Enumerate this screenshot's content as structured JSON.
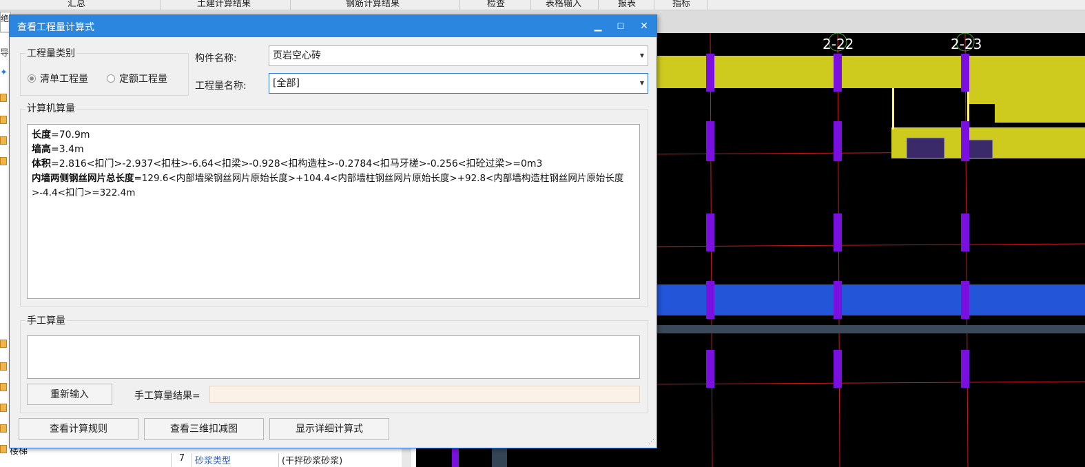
{
  "menu": [
    "汇总",
    "土建计算结果",
    "钢筋计算结果",
    "检查",
    "表格输入",
    "报表",
    "指标"
  ],
  "tab_fragment": "绝",
  "left_fragment": "导",
  "bottom_grid": {
    "row_num": "7",
    "name": "砂浆类型",
    "value": "(干拌砂浆砂浆)",
    "label": "楼梯"
  },
  "cad": {
    "axis_labels": [
      "2-22",
      "2-23"
    ]
  },
  "dialog": {
    "title": "查看工程量计算式",
    "minimize": "▁",
    "maximize": "☐",
    "close": "✕",
    "quantity_type": {
      "group_label": "工程量类别",
      "options": [
        {
          "label": "清单工程量",
          "selected": true
        },
        {
          "label": "定额工程量",
          "selected": false
        }
      ]
    },
    "component_name": {
      "label": "构件名称:",
      "value": "页岩空心砖"
    },
    "quantity_name": {
      "label": "工程量名称:",
      "value": "[全部]"
    },
    "computer_calc": {
      "group_label": "计算机算量",
      "lines": [
        {
          "key": "长度",
          "expr": "=70.9m"
        },
        {
          "key": "墙高",
          "expr": "=3.4m"
        },
        {
          "key": "体积",
          "expr": "=2.816<扣门>-2.937<扣柱>-6.64<扣梁>-0.928<扣构造柱>-0.2784<扣马牙槎>-0.256<扣砼过梁>=0m3"
        },
        {
          "key": "内墙两侧钢丝网片总长度",
          "expr": "=129.6<内部墙梁钢丝网片原始长度>+104.4<内部墙柱钢丝网片原始长度>+92.8<内部墙构造柱钢丝网片原始长度>-4.4<扣门>=322.4m"
        }
      ]
    },
    "manual_calc": {
      "group_label": "手工算量",
      "reenter_button": "重新输入",
      "result_label": "手工算量结果=",
      "result_value": ""
    },
    "buttons": {
      "view_rules": "查看计算规则",
      "view_3d": "查看三维扣减图",
      "show_detail": "显示详细计算式"
    }
  }
}
